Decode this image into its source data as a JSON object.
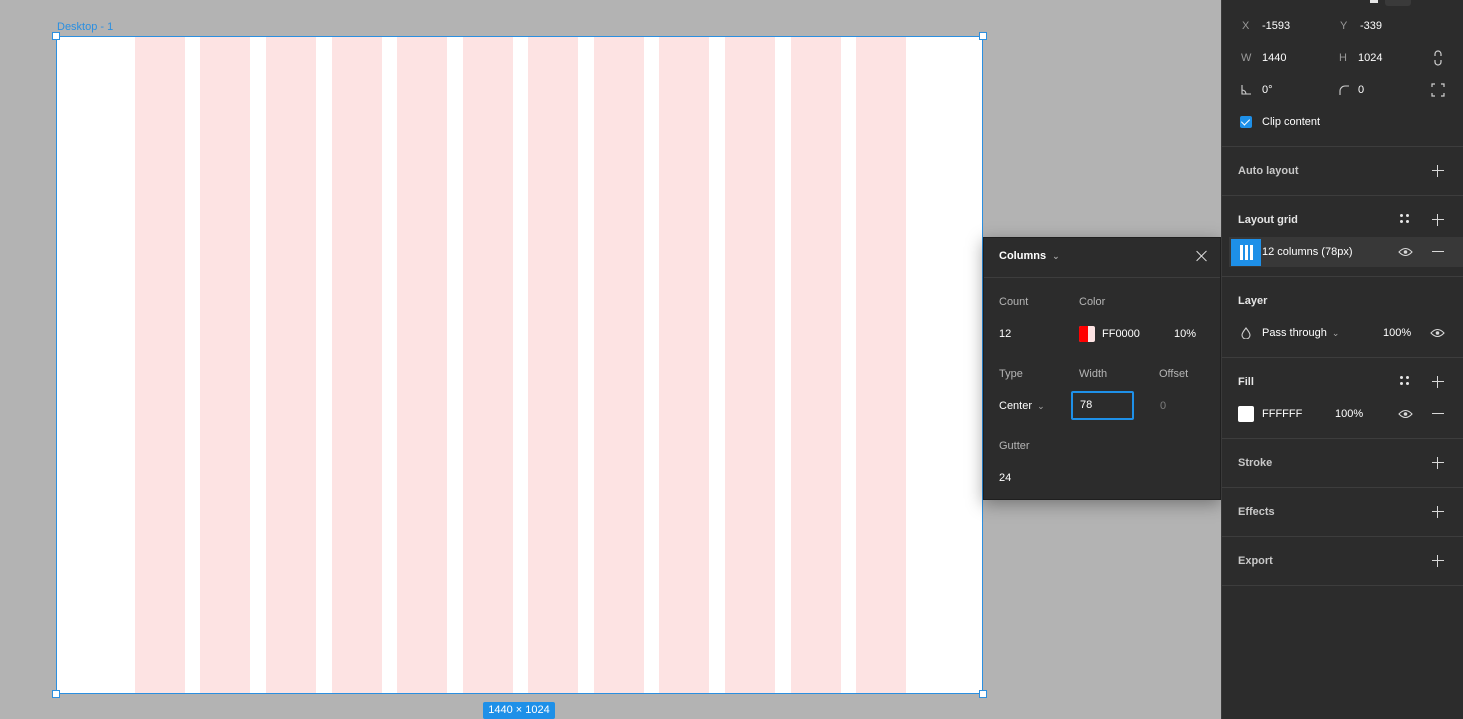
{
  "canvas": {
    "frame_label": "Desktop - 1",
    "size_badge": "1440 × 1024",
    "grid_color": "#fde3e3",
    "selection_color": "#2b8fe0"
  },
  "panel": {
    "x_label": "X",
    "x_value": "-1593",
    "y_label": "Y",
    "y_value": "-339",
    "w_label": "W",
    "w_value": "1440",
    "h_label": "H",
    "h_value": "1024",
    "rotation_value": "0°",
    "radius_value": "0",
    "clip_content_label": "Clip content",
    "auto_layout_title": "Auto layout",
    "layout_grid_title": "Layout grid",
    "layout_grid_item": "12 columns (78px)",
    "layer_title": "Layer",
    "blend_mode": "Pass through",
    "layer_opacity": "100%",
    "fill_title": "Fill",
    "fill_hex": "FFFFFF",
    "fill_opacity": "100%",
    "stroke_title": "Stroke",
    "effects_title": "Effects",
    "export_title": "Export"
  },
  "popover": {
    "title": "Columns",
    "count_label": "Count",
    "count_value": "12",
    "color_label": "Color",
    "color_hex": "FF0000",
    "color_opacity": "10%",
    "type_label": "Type",
    "type_value": "Center",
    "width_label": "Width",
    "width_value": "78",
    "offset_label": "Offset",
    "offset_value": "0",
    "gutter_label": "Gutter",
    "gutter_value": "24"
  },
  "colors": {
    "accent": "#1e90e8",
    "panel_bg": "#2c2c2c",
    "canvas_bg": "#b3b3b3"
  }
}
